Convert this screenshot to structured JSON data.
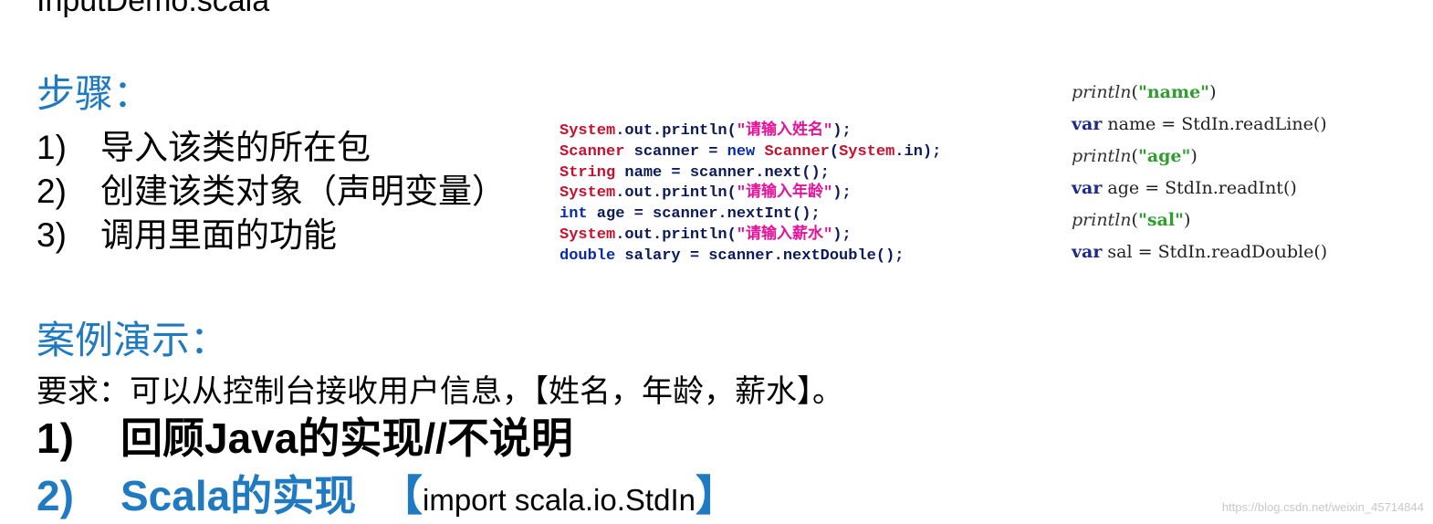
{
  "top_title": "InputDemo.scala",
  "steps_section": {
    "heading": "步骤：",
    "items": [
      {
        "num": "1)",
        "text": "导入该类的所在包"
      },
      {
        "num": "2)",
        "text": "创建该类对象（声明变量）"
      },
      {
        "num": "3)",
        "text": "调用里面的功能"
      }
    ]
  },
  "java_code": {
    "lines": [
      [
        {
          "t": "System",
          "c": "kw-red"
        },
        {
          "t": ".out.println(",
          "c": "plain"
        },
        {
          "t": "\"请输入姓名\"",
          "c": "str"
        },
        {
          "t": ");",
          "c": "plain"
        }
      ],
      [
        {
          "t": "Scanner",
          "c": "kw-red"
        },
        {
          "t": " scanner = ",
          "c": "plain"
        },
        {
          "t": "new",
          "c": "kw-blue"
        },
        {
          "t": " ",
          "c": "plain"
        },
        {
          "t": "Scanner",
          "c": "kw-red"
        },
        {
          "t": "(",
          "c": "plain"
        },
        {
          "t": "System",
          "c": "kw-red"
        },
        {
          "t": ".in);",
          "c": "plain"
        }
      ],
      [
        {
          "t": "String",
          "c": "kw-red"
        },
        {
          "t": " name = scanner.next();",
          "c": "plain"
        }
      ],
      [
        {
          "t": "System",
          "c": "kw-red"
        },
        {
          "t": ".out.println(",
          "c": "plain"
        },
        {
          "t": "\"请输入年龄\"",
          "c": "str"
        },
        {
          "t": ");",
          "c": "plain"
        }
      ],
      [
        {
          "t": "int",
          "c": "kw-blue"
        },
        {
          "t": " age = scanner.nextInt();",
          "c": "plain"
        }
      ],
      [
        {
          "t": "System",
          "c": "kw-red"
        },
        {
          "t": ".out.println(",
          "c": "plain"
        },
        {
          "t": "\"请输入薪水\"",
          "c": "str"
        },
        {
          "t": ");",
          "c": "plain"
        }
      ],
      [
        {
          "t": "double",
          "c": "kw-blue"
        },
        {
          "t": " salary = scanner.nextDouble();",
          "c": "plain"
        }
      ]
    ]
  },
  "scala_code": {
    "lines": [
      [
        {
          "t": "println",
          "c": "fn"
        },
        {
          "t": "(",
          "c": ""
        },
        {
          "t": "\"name\"",
          "c": "str"
        },
        {
          "t": ")",
          "c": ""
        }
      ],
      [
        {
          "t": "var",
          "c": "kw"
        },
        {
          "t": " name = StdIn.readLine()",
          "c": ""
        }
      ],
      [
        {
          "t": "println",
          "c": "fn"
        },
        {
          "t": "(",
          "c": ""
        },
        {
          "t": "\"age\"",
          "c": "str"
        },
        {
          "t": ")",
          "c": ""
        }
      ],
      [
        {
          "t": "var",
          "c": "kw"
        },
        {
          "t": " age = StdIn.readInt()",
          "c": ""
        }
      ],
      [
        {
          "t": "println",
          "c": "fn"
        },
        {
          "t": "(",
          "c": ""
        },
        {
          "t": "\"sal\"",
          "c": "str"
        },
        {
          "t": ")",
          "c": ""
        }
      ],
      [
        {
          "t": "var",
          "c": "kw"
        },
        {
          "t": " sal = StdIn.readDouble()",
          "c": ""
        }
      ]
    ]
  },
  "case_section": {
    "heading": "案例演示：",
    "requirement": "要求：可以从控制台接收用户信息，【姓名，年龄，薪水】。",
    "item1": {
      "num": "1)",
      "text": "回顾Java的实现//不说明"
    },
    "item2": {
      "num": "2)",
      "text": "Scala的实现",
      "bracket_open": "【",
      "note": "import scala.io.StdIn",
      "bracket_close": "】"
    }
  },
  "watermark": "https://blog.csdn.net/weixin_45714844",
  "colors": {
    "heading_blue": "#1f7ac1",
    "java_keyword_red": "#c8102e",
    "java_string_magenta": "#e4139b",
    "scala_string_green": "#2e9e2e"
  }
}
